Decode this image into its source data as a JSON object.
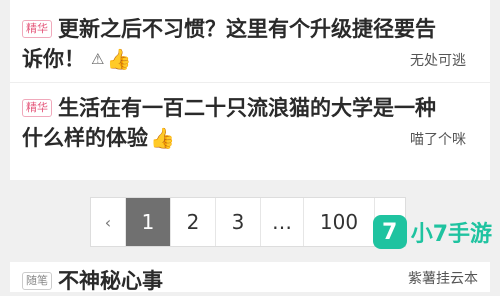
{
  "posts": [
    {
      "badge": "精华",
      "title_line1": "更新之后不习惯？这里有个升级捷径要告",
      "title_line2": "诉你！",
      "author": "无处可逃"
    },
    {
      "badge": "精华",
      "title_line1": "生活在有一百二十只流浪猫的大学是一种",
      "title_line2": "什么样的体验",
      "author": "喵了个咪"
    }
  ],
  "pagination": {
    "prev": "‹",
    "pages": [
      "1",
      "2",
      "3",
      "…",
      "100"
    ],
    "next": "›",
    "active_index": 0
  },
  "bottom_post": {
    "badge": "随笔",
    "title": "不神秘心事",
    "author": "紫薯挂云本"
  },
  "watermark": {
    "logo": "7",
    "text": "小7手游"
  },
  "icons": {
    "warning": "warning-icon",
    "like": "thumbs-up-icon"
  },
  "colors": {
    "accent": "#e4567a",
    "active_page": "#707070",
    "watermark": "#1fc3a0"
  }
}
